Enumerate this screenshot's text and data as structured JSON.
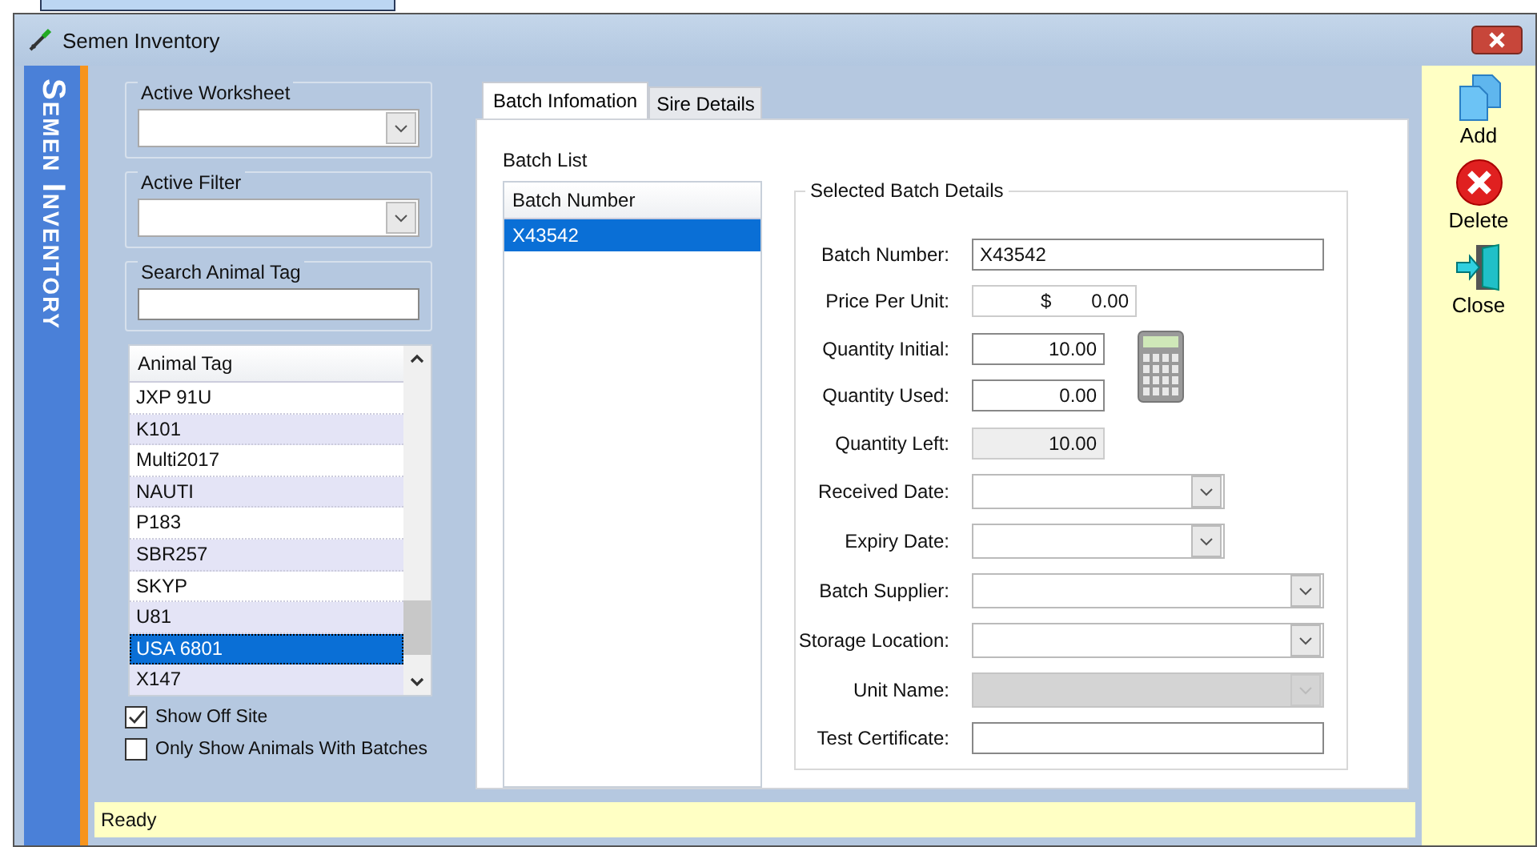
{
  "window": {
    "title": "Semen Inventory",
    "side_title": "Semen Inventory"
  },
  "left_panel": {
    "active_worksheet": {
      "label": "Active Worksheet"
    },
    "active_filter": {
      "label": "Active Filter"
    },
    "search": {
      "label": "Search Animal Tag"
    },
    "animal_grid": {
      "column": "Animal Tag",
      "rows": [
        {
          "tag": "JXP 91U",
          "selected": false
        },
        {
          "tag": "K101",
          "selected": false
        },
        {
          "tag": "Multi2017",
          "selected": false
        },
        {
          "tag": "NAUTI",
          "selected": false
        },
        {
          "tag": "P183",
          "selected": false
        },
        {
          "tag": "SBR257",
          "selected": false
        },
        {
          "tag": "SKYP",
          "selected": false
        },
        {
          "tag": "U81",
          "selected": false
        },
        {
          "tag": "USA 6801",
          "selected": true
        },
        {
          "tag": "X147",
          "selected": false
        }
      ]
    },
    "checkboxes": [
      {
        "label": "Show Off Site",
        "checked": true
      },
      {
        "label": "Only Show Animals With Batches",
        "checked": false
      }
    ]
  },
  "tabs": [
    {
      "label": "Batch Infomation",
      "selected": true
    },
    {
      "label": "Sire Details",
      "selected": false
    }
  ],
  "batch_list": {
    "title": "Batch List",
    "column": "Batch Number",
    "rows": [
      {
        "number": "X43542",
        "selected": true
      }
    ]
  },
  "details": {
    "title": "Selected Batch Details",
    "fields": [
      {
        "label": "Batch Number:",
        "kind": "text",
        "value": "X43542"
      },
      {
        "label": "Price Per Unit:",
        "kind": "currency",
        "prefix": "$",
        "value": "0.00"
      },
      {
        "label": "Quantity Initial:",
        "kind": "number",
        "value": "10.00"
      },
      {
        "label": "Quantity Used:",
        "kind": "number",
        "value": "0.00"
      },
      {
        "label": "Quantity Left:",
        "kind": "readonly",
        "value": "10.00"
      },
      {
        "label": "Received Date:",
        "kind": "date"
      },
      {
        "label": "Expiry Date:",
        "kind": "date"
      },
      {
        "label": "Batch Supplier:",
        "kind": "combo",
        "disabled": false
      },
      {
        "label": "Storage Location:",
        "kind": "combo",
        "disabled": false
      },
      {
        "label": "Unit Name:",
        "kind": "combo",
        "disabled": true
      },
      {
        "label": "Test Certificate:",
        "kind": "text"
      }
    ]
  },
  "toolbar": [
    {
      "label": "Add",
      "kind": "add"
    },
    {
      "label": "Delete",
      "kind": "delete"
    },
    {
      "label": "Close",
      "kind": "close"
    }
  ],
  "status_bar": {
    "text": "Ready"
  }
}
